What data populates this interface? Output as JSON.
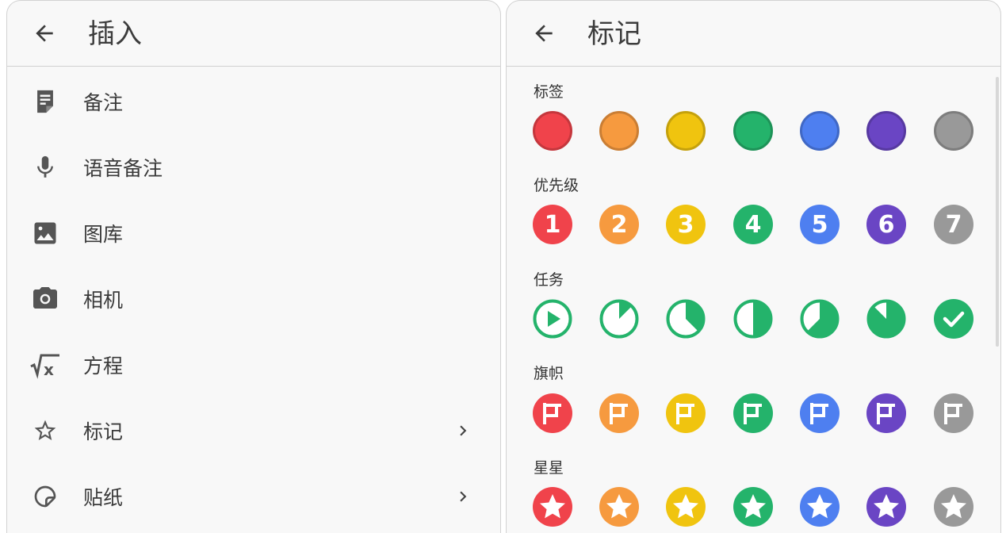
{
  "left": {
    "title": "插入",
    "items": [
      {
        "label": "备注",
        "icon": "note-icon",
        "chevron": false
      },
      {
        "label": "语音备注",
        "icon": "microphone-icon",
        "chevron": false
      },
      {
        "label": "图库",
        "icon": "image-icon",
        "chevron": false
      },
      {
        "label": "相机",
        "icon": "camera-icon",
        "chevron": false
      },
      {
        "label": "方程",
        "icon": "equation-icon",
        "chevron": false
      },
      {
        "label": "标记",
        "icon": "star-outline-icon",
        "chevron": true
      },
      {
        "label": "贴纸",
        "icon": "sticker-icon",
        "chevron": true
      }
    ]
  },
  "right": {
    "title": "标记",
    "colors": [
      "#f0434b",
      "#f69a3f",
      "#f0c40f",
      "#24b36b",
      "#4e7ff0",
      "#6a45c4",
      "#999999"
    ],
    "task_green": "#24b36b",
    "sections": [
      {
        "key": "tags",
        "label": "标签"
      },
      {
        "key": "priority",
        "label": "优先级",
        "numbers": [
          "1",
          "2",
          "3",
          "4",
          "5",
          "6",
          "7"
        ]
      },
      {
        "key": "task",
        "label": "任务",
        "progress": [
          0,
          0.125,
          0.375,
          0.5,
          0.625,
          0.875,
          1
        ]
      },
      {
        "key": "flags",
        "label": "旗帜"
      },
      {
        "key": "stars",
        "label": "星星"
      }
    ]
  }
}
